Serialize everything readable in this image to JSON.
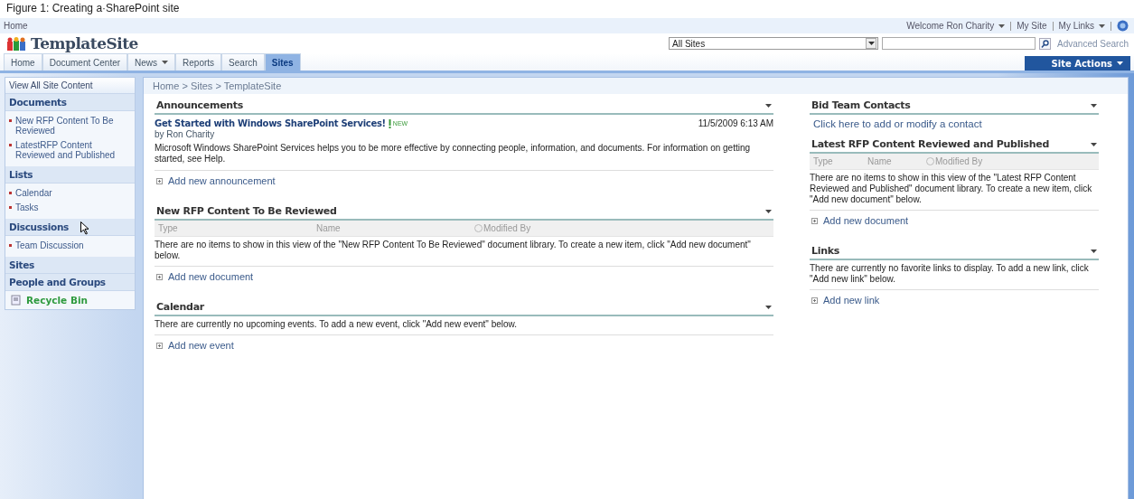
{
  "caption": "Figure 1: Creating a·SharePoint site",
  "top_bar": {
    "home": "Home",
    "welcome": "Welcome Ron Charity",
    "my_site": "My Site",
    "my_links": "My Links"
  },
  "site_title": "TemplateSite",
  "search": {
    "scope": "All Sites",
    "advanced": "Advanced Search"
  },
  "tabs": [
    {
      "label": "Home",
      "dropdown": false,
      "selected": false
    },
    {
      "label": "Document Center",
      "dropdown": false,
      "selected": false
    },
    {
      "label": "News",
      "dropdown": true,
      "selected": false
    },
    {
      "label": "Reports",
      "dropdown": false,
      "selected": false
    },
    {
      "label": "Search",
      "dropdown": false,
      "selected": false
    },
    {
      "label": "Sites",
      "dropdown": false,
      "selected": true
    }
  ],
  "site_actions": "Site Actions",
  "quick_launch": {
    "view_all": "View All Site Content",
    "sections": [
      {
        "heading": "Documents",
        "items": [
          "New RFP Content To Be Reviewed",
          "LatestRFP Content Reviewed and Published"
        ]
      },
      {
        "heading": "Lists",
        "items": [
          "Calendar",
          "Tasks"
        ]
      },
      {
        "heading": "Discussions",
        "items": [
          "Team Discussion"
        ]
      },
      {
        "heading": "Sites"
      },
      {
        "heading": "People and Groups"
      }
    ],
    "recycle_bin": "Recycle Bin"
  },
  "breadcrumb": "Home > Sites > TemplateSite",
  "left_zone": [
    {
      "kind": "announcements",
      "title": "Announcements",
      "item": {
        "title": "Get Started with Windows SharePoint Services!",
        "badge": "NEW",
        "date": "11/5/2009 6:13 AM",
        "author": "by Ron Charity",
        "body": "Microsoft Windows SharePoint Services helps you to be more effective by connecting people, information, and documents. For information on getting started, see Help."
      },
      "add": "Add new announcement"
    },
    {
      "kind": "library",
      "title": "New RFP Content To Be Reviewed",
      "columns": [
        "Type",
        "Name",
        "Modified By"
      ],
      "message": "There are no items to show in this view of the \"New RFP Content To Be Reviewed\" document library. To create a new item, click \"Add new document\" below.",
      "add": "Add new document"
    },
    {
      "kind": "list",
      "title": "Calendar",
      "message": "There are currently no upcoming events. To add a new event, click \"Add new event\" below.",
      "add": "Add new event"
    }
  ],
  "right_zone": [
    {
      "kind": "contacts",
      "title": "Bid Team Contacts",
      "link": "Click here to add or modify a contact"
    },
    {
      "kind": "library",
      "title": "Latest RFP Content Reviewed and Published",
      "columns": [
        "Type",
        "Name",
        "Modified By"
      ],
      "message": "There are no items to show in this view of the \"Latest RFP Content Reviewed and Published\" document library. To create a new item, click \"Add new document\" below.",
      "add": "Add new document"
    },
    {
      "kind": "list",
      "title": "Links",
      "message": "There are currently no favorite links to display. To add a new link, click \"Add new link\" below.",
      "add": "Add new link"
    }
  ]
}
